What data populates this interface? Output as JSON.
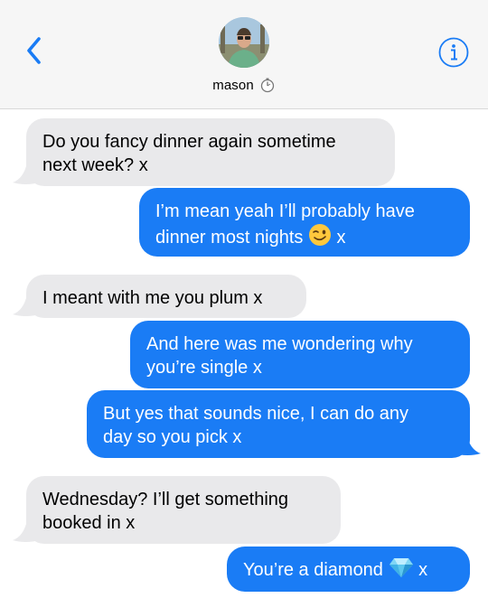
{
  "header": {
    "contact_name": "mason",
    "icons": {
      "back": "chevron-left-icon",
      "info": "info-circle-icon",
      "timer": "stopwatch-icon"
    }
  },
  "colors": {
    "sent_bubble": "#1a7cf5",
    "received_bubble": "#e9e9eb",
    "accent": "#1a7cf5"
  },
  "messages": [
    {
      "from": "them",
      "text": "Do you fancy dinner again sometime\nnext week? x"
    },
    {
      "from": "me",
      "text_a": "I’m mean yeah I’ll probably have\ndinner most nights",
      "emoji": "winking-face-emoji",
      "text_b": "x"
    },
    {
      "from": "them",
      "text": "I meant with me you plum x"
    },
    {
      "from": "me",
      "text": "And here was me wondering why\nyou’re single x"
    },
    {
      "from": "me",
      "text": "But yes that sounds nice, I can do any\nday so you pick x"
    },
    {
      "from": "them",
      "text": "Wednesday? I’ll get something\nbooked in x"
    },
    {
      "from": "me",
      "text_a": "You’re a diamond",
      "emoji": "gem-stone-emoji",
      "text_b": "x"
    }
  ]
}
